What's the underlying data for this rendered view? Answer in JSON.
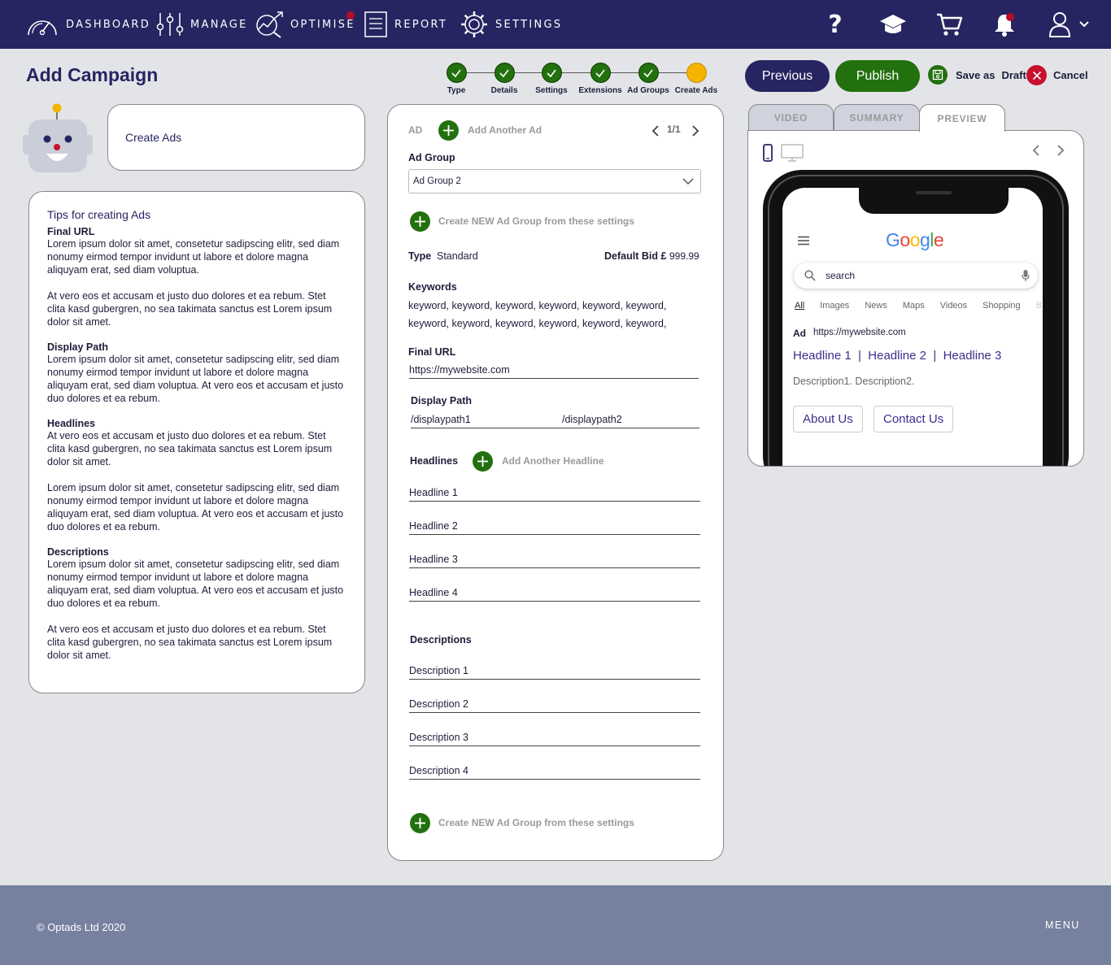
{
  "nav": {
    "items": [
      {
        "label": "DASHBOARD",
        "icon": "speedometer-icon"
      },
      {
        "label": "MANAGE",
        "icon": "sliders-icon"
      },
      {
        "label": "OPTIMISE",
        "icon": "trend-magnify-icon"
      },
      {
        "label": "REPORT",
        "icon": "report-doc-icon"
      },
      {
        "label": "SETTINGS",
        "icon": "gear-icon"
      }
    ],
    "right_icons": [
      "help-icon",
      "graduation-cap-icon",
      "cart-icon",
      "bell-icon",
      "user-icon"
    ],
    "accent_dot_color": "#b30d2a",
    "bar_color": "#262561"
  },
  "page": {
    "title": "Add Campaign"
  },
  "stepper": {
    "steps": [
      "Type",
      "Details",
      "Settings",
      "Extensions",
      "Ad Groups",
      "Create Ads"
    ],
    "completed_color": "#22700e",
    "current_color": "#f5b400"
  },
  "actions": {
    "previous": "Previous",
    "publish": "Publish",
    "save_draft_1": "Save as",
    "save_draft_2": "Draft",
    "cancel": "Cancel"
  },
  "left": {
    "create_ads": "Create Ads",
    "tips_title": "Tips for creating Ads",
    "final_url_head": "Final URL",
    "final_url_p1": "Lorem ipsum dolor sit amet, consetetur sadipscing elitr, sed diam nonumy eirmod tempor invidunt ut labore et dolore magna aliquyam erat, sed diam voluptua.",
    "final_url_p2": "At vero eos et accusam et justo duo dolores et ea rebum. Stet clita kasd gubergren, no sea takimata sanctus est Lorem ipsum dolor sit amet.",
    "display_path_head": "Display Path",
    "display_path_p1": "Lorem ipsum dolor sit amet, consetetur sadipscing elitr, sed diam nonumy eirmod tempor invidunt ut labore et dolore magna aliquyam erat, sed diam voluptua. At vero eos et accusam et justo duo dolores et ea rebum.",
    "headlines_head": "Headlines",
    "headlines_p1": "At vero eos et accusam et justo duo dolores et ea rebum. Stet clita kasd gubergren, no sea takimata sanctus est Lorem ipsum dolor sit amet.",
    "headlines_p2": "Lorem ipsum dolor sit amet, consetetur sadipscing elitr, sed diam nonumy eirmod tempor invidunt ut labore et dolore magna aliquyam erat, sed diam voluptua. At vero eos et accusam et justo duo dolores et ea rebum.",
    "descriptions_head": "Descriptions",
    "descriptions_p1": "Lorem ipsum dolor sit amet, consetetur sadipscing elitr, sed diam nonumy eirmod tempor invidunt ut labore et dolore magna aliquyam erat, sed diam voluptua. At vero eos et accusam et justo duo dolores et ea rebum.",
    "descriptions_p2": "At vero eos et accusam et justo duo dolores et ea rebum. Stet clita kasd gubergren, no sea takimata sanctus est Lorem ipsum dolor sit amet."
  },
  "form": {
    "ad_label": "AD",
    "add_another_ad": "Add Another Ad",
    "pager": "1/1",
    "ad_group_label": "Ad Group",
    "ad_group_value": "Ad Group 2",
    "create_new_group": "Create NEW Ad Group from these settings",
    "type_label": "Type",
    "type_value": "Standard",
    "default_bid_label": "Default Bid £",
    "default_bid_value": "999.99",
    "keywords_label": "Keywords",
    "keywords_line1": "keyword, keyword, keyword, keyword, keyword, keyword,",
    "keywords_line2": "keyword, keyword, keyword, keyword, keyword, keyword,",
    "final_url_label": "Final URL",
    "final_url_value": "https://mywebsite.com",
    "display_path_label": "Display Path",
    "display_path1": "/displaypath1",
    "display_path2": "/displaypath2",
    "headlines_label": "Headlines",
    "add_another_headline": "Add Another Headline",
    "headlines": [
      "Headline 1",
      "Headline 2",
      "Headline 3",
      "Headline 4"
    ],
    "descriptions_label": "Descriptions",
    "descriptions": [
      "Description 1",
      "Description 2",
      "Description 3",
      "Description 4"
    ],
    "create_new_group_bottom": "Create NEW Ad Group from these settings"
  },
  "preview": {
    "tabs": [
      "VIDEO",
      "SUMMARY",
      "PREVIEW"
    ],
    "active_tab": "PREVIEW",
    "search_placeholder": "search",
    "google_tabs": [
      "All",
      "Images",
      "News",
      "Maps",
      "Videos",
      "Shopping",
      "B"
    ],
    "ad_badge": "Ad",
    "ad_url": "https://mywebsite.com",
    "headline": "Headline 1  |  Headline 2  |  Headline 3",
    "description": "Description1. Description2.",
    "sitelink1": "About Us",
    "sitelink2": "Contact Us"
  },
  "footer": {
    "copyright": "© Optads Ltd 2020",
    "menu": "MENU"
  }
}
